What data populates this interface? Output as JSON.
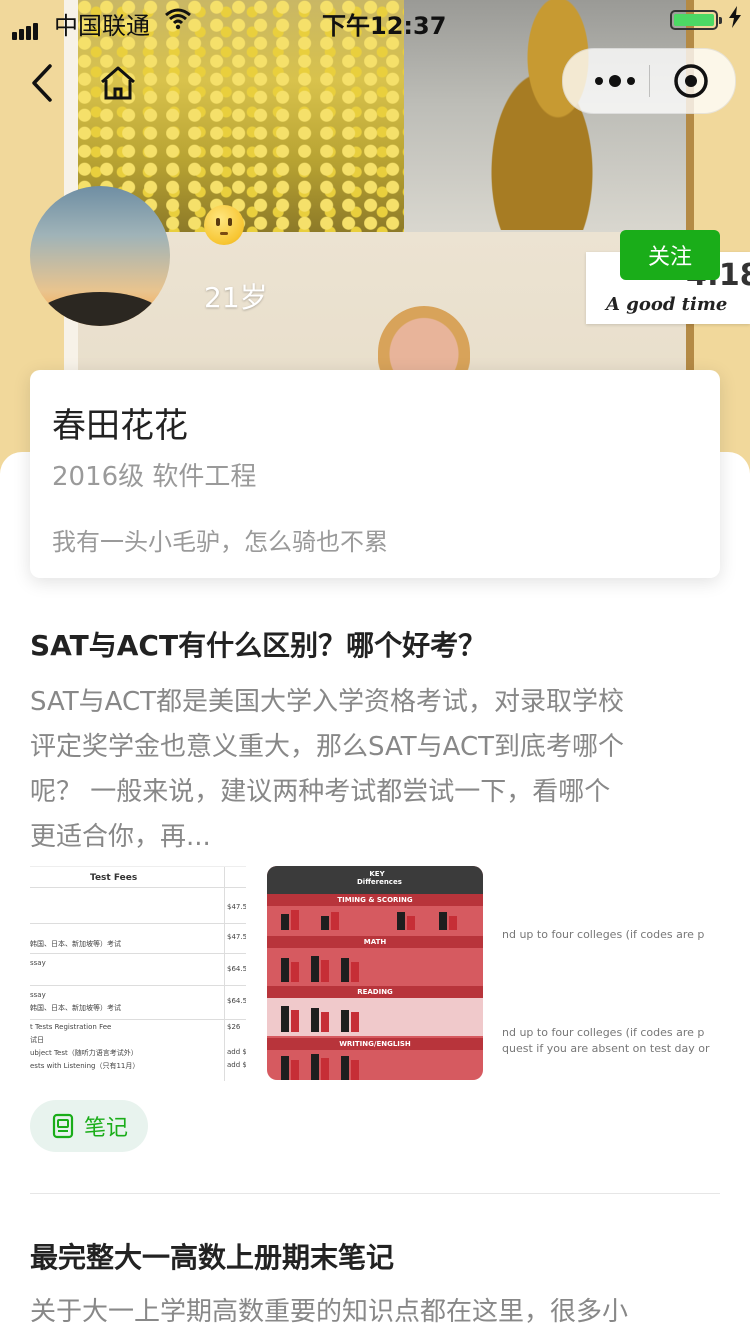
{
  "status_bar": {
    "carrier": "中国联通",
    "time": "下午12:37"
  },
  "header": {
    "cover_overlay_big": "4:18",
    "cover_overlay_small": "A good time"
  },
  "profile": {
    "age": "21岁",
    "follow_label": "关注",
    "name": "春田花花",
    "major": "2016级 软件工程",
    "bio": "我有一头小毛驴，怎么骑也不累"
  },
  "posts": [
    {
      "title": "SAT与ACT有什么区别？哪个好考？",
      "body_lines": [
        "SAT与ACT都是美国大学入学资格考试，对录取学校",
        "评定奖学金也意义重大，那么SAT与ACT到底考哪个",
        "呢？ 一般来说，建议两种考试都尝试一下，看哪个",
        "更适合你，再..."
      ],
      "tag": "笔记",
      "images": {
        "fees": {
          "title": "Test Fees",
          "rows": [
            {
              "left": "",
              "right": "$47.5"
            },
            {
              "left": "韩国、日本、新加坡等）考试",
              "right": "$47.5"
            },
            {
              "left": "ssay",
              "right": "$64.5"
            },
            {
              "left": "ssay",
              "right": "$64.5"
            },
            {
              "left": "韩国、日本、新加坡等）考试",
              "right": ""
            },
            {
              "left": "t Tests Registration Fee",
              "right": "$26"
            },
            {
              "left": "试日",
              "right": ""
            },
            {
              "left": "ubject Test（随听力语言考试外）",
              "right": "add $"
            },
            {
              "left": "ests with Listening（只有11月）",
              "right": "add $"
            }
          ]
        },
        "infographic": {
          "title": "KEY Differences",
          "sections": [
            "TIMING & SCORING",
            "MATH",
            "READING",
            "WRITING/ENGLISH"
          ]
        },
        "text_snippet": {
          "lines": [
            "nd up to four colleges (if codes are p",
            "nd up to four colleges (if codes are p",
            "quest if you are absent on test day or"
          ]
        }
      }
    },
    {
      "title": "最完整大一高数上册期末笔记",
      "body_lines": [
        "关于大一上学期高数重要的知识点都在这里，很多小"
      ]
    }
  ]
}
